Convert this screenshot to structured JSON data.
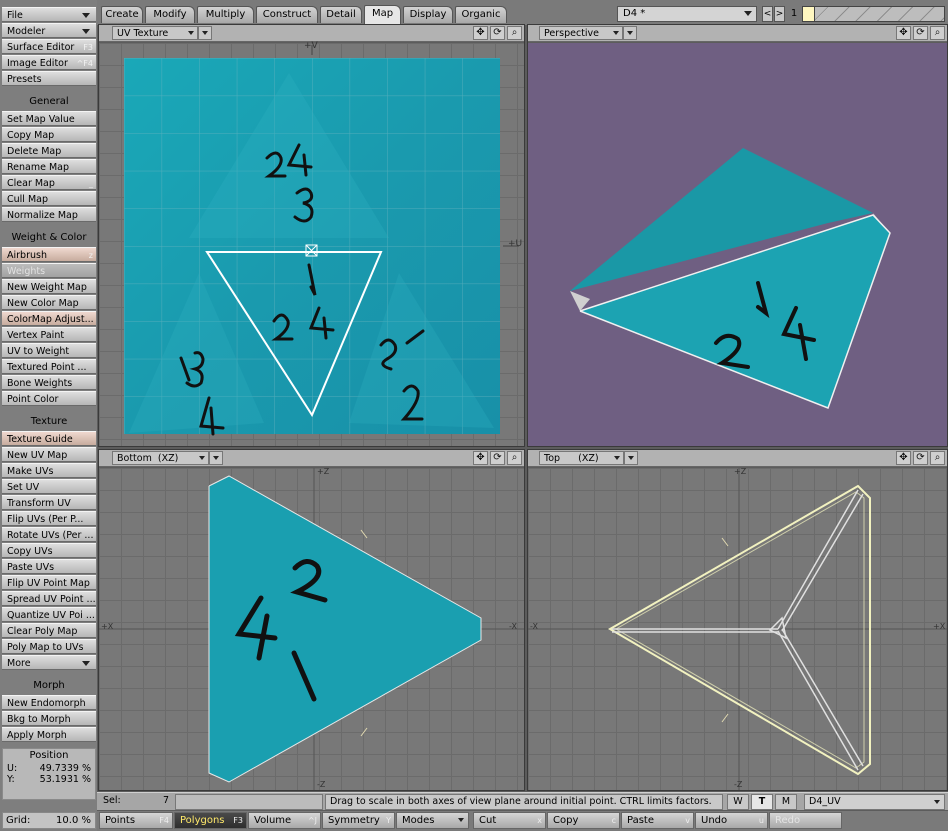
{
  "sidebar": {
    "top_items": [
      {
        "label": "File",
        "dropdown": true
      },
      {
        "label": "Modeler",
        "dropdown": true
      },
      {
        "label": "Surface Editor",
        "shortcut": "F3"
      },
      {
        "label": "Image Editor",
        "shortcut": "^F4"
      },
      {
        "label": "Presets"
      }
    ],
    "general_header": "General",
    "general_items": [
      {
        "label": "Set Map Value"
      },
      {
        "label": "Copy Map"
      },
      {
        "label": "Delete Map"
      },
      {
        "label": "Rename Map"
      },
      {
        "label": "Clear Map",
        "shortcut": "_"
      },
      {
        "label": "Cull Map"
      },
      {
        "label": "Normalize Map"
      }
    ],
    "weight_header": "Weight & Color",
    "weight_items": [
      {
        "label": "Airbrush",
        "shortcut": "z",
        "hot": true
      },
      {
        "label": "Weights",
        "disabled": true
      },
      {
        "label": "New Weight Map"
      },
      {
        "label": "New Color Map"
      },
      {
        "label": "ColorMap Adjust...",
        "hot": true
      },
      {
        "label": "Vertex Paint"
      },
      {
        "label": "UV to Weight"
      },
      {
        "label": "Textured Point ..."
      },
      {
        "label": "Bone Weights"
      },
      {
        "label": "Point Color"
      }
    ],
    "texture_header": "Texture",
    "texture_items": [
      {
        "label": "Texture Guide",
        "hot": true
      },
      {
        "label": "New UV Map"
      },
      {
        "label": "Make UVs"
      },
      {
        "label": "Set UV"
      },
      {
        "label": "Transform UV"
      },
      {
        "label": "Flip UVs (Per P..."
      },
      {
        "label": "Rotate UVs (Per ..."
      },
      {
        "label": "Copy UVs"
      },
      {
        "label": "Paste UVs"
      },
      {
        "label": "Flip UV Point Map"
      },
      {
        "label": "Spread UV Point ..."
      },
      {
        "label": "Quantize UV Poi ..."
      },
      {
        "label": "Clear Poly Map"
      },
      {
        "label": "Poly Map to UVs"
      },
      {
        "label": "More",
        "dropdown": true
      }
    ],
    "morph_header": "Morph",
    "morph_items": [
      {
        "label": "New Endomorph"
      },
      {
        "label": "Bkg to Morph"
      },
      {
        "label": "Apply Morph"
      }
    ],
    "position": {
      "title": "Position",
      "u_label": "U:",
      "u_value": "49.7339 %",
      "v_label": "Y:",
      "v_value": "53.1931 %"
    },
    "grid": {
      "label": "Grid:",
      "value": "10.0 %"
    }
  },
  "tabs": [
    {
      "label": "Create"
    },
    {
      "label": "Modify"
    },
    {
      "label": "Multiply"
    },
    {
      "label": "Construct"
    },
    {
      "label": "Detail"
    },
    {
      "label": "Map",
      "selected": true
    },
    {
      "label": "Display"
    },
    {
      "label": "Organic"
    }
  ],
  "scene": {
    "name": "D4 *",
    "prev": "<",
    "next": ">",
    "layer_number": "1"
  },
  "viewports": {
    "uv": {
      "view": "UV Texture",
      "axis_top": "+V",
      "axis_right": "+U"
    },
    "persp": {
      "view": "Perspective"
    },
    "bottom": {
      "view": "Bottom",
      "axis": "(XZ)",
      "axis_top": "+Z",
      "axis_bottom": "-Z",
      "axis_left": "+X",
      "axis_right": "-X"
    },
    "top": {
      "view": "Top",
      "axis": "(XZ)",
      "axis_top": "+Z",
      "axis_bottom": "-Z",
      "axis_left": "-X",
      "axis_right": "+X"
    },
    "icons": {
      "move": "✥",
      "rotate": "⟳",
      "zoom": "⌕"
    }
  },
  "status": {
    "sel_label": "Sel:",
    "sel_value": "7",
    "message": "Drag to scale in both axes of view plane around initial point. CTRL limits factors.",
    "w": "W",
    "t": "T",
    "m": "M",
    "map_name": "D4_UV"
  },
  "modes": [
    {
      "label": "Points",
      "shortcut": "F4"
    },
    {
      "label": "Polygons",
      "shortcut": "F3",
      "active": true
    },
    {
      "label": "Volume",
      "shortcut": "^J"
    },
    {
      "label": "Symmetry",
      "shortcut": "Y"
    },
    {
      "label": "Modes",
      "dropdown": true
    },
    {
      "label": "Cut",
      "shortcut": "x"
    },
    {
      "label": "Copy",
      "shortcut": "c"
    },
    {
      "label": "Paste",
      "shortcut": "v"
    },
    {
      "label": "Undo",
      "shortcut": "u"
    },
    {
      "label": "Redo",
      "disabled": true
    }
  ],
  "colors": {
    "teal": "#1a9eb0",
    "persp_bg": "#6f5f82",
    "grid": "#787878",
    "selection": "#f2f2c0"
  }
}
